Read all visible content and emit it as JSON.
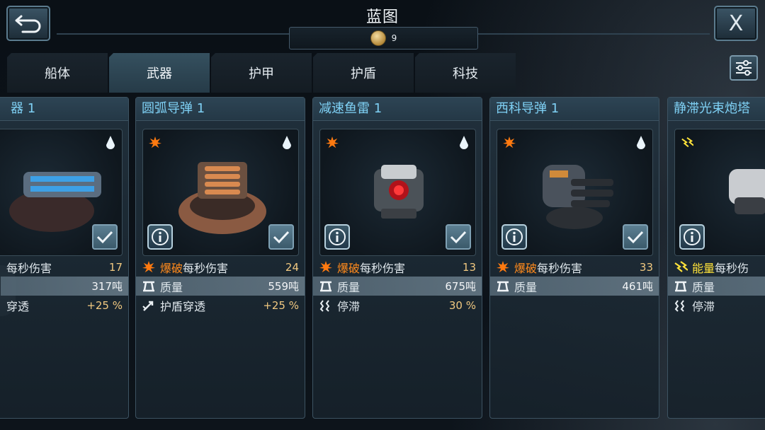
{
  "header": {
    "title": "蓝图",
    "coins": "9",
    "close_label": "X"
  },
  "tabs": [
    {
      "label": "船体",
      "active": false
    },
    {
      "label": "武器",
      "active": true
    },
    {
      "label": "护甲",
      "active": false
    },
    {
      "label": "护盾",
      "active": false
    },
    {
      "label": "科技",
      "active": false
    }
  ],
  "colors": {
    "accent_title": "#7fd1f5",
    "explosive": "#ff8a1c",
    "energy": "#ffe33a",
    "value": "#f0c880"
  },
  "cards": [
    {
      "title": "器 1",
      "stats": [
        {
          "icon": "dps-icon",
          "prefix": "",
          "label": "每秒伤害",
          "value": "17"
        },
        {
          "icon": "mass-icon",
          "prefix": "",
          "label": "",
          "value": "317吨"
        },
        {
          "icon": "penetration-icon",
          "prefix": "",
          "label": "穿透",
          "value": "+25 %"
        }
      ]
    },
    {
      "title": "圆弧导弹 1",
      "type_icon": "explosive-icon",
      "stats": [
        {
          "icon": "explosive-icon",
          "prefix": "爆破",
          "label": "每秒伤害",
          "value": "24"
        },
        {
          "icon": "mass-icon",
          "prefix": "",
          "label": "质量",
          "value": "559吨"
        },
        {
          "icon": "shield-penetration-icon",
          "prefix": "",
          "label": "护盾穿透",
          "value": "+25 %"
        }
      ]
    },
    {
      "title": "减速鱼雷 1",
      "type_icon": "explosive-icon",
      "stats": [
        {
          "icon": "explosive-icon",
          "prefix": "爆破",
          "label": "每秒伤害",
          "value": "13"
        },
        {
          "icon": "mass-icon",
          "prefix": "",
          "label": "质量",
          "value": "675吨"
        },
        {
          "icon": "stasis-icon",
          "prefix": "",
          "label": "停滞",
          "value": "30 %"
        }
      ]
    },
    {
      "title": "西科导弹 1",
      "type_icon": "explosive-icon",
      "stats": [
        {
          "icon": "explosive-icon",
          "prefix": "爆破",
          "label": "每秒伤害",
          "value": "33"
        },
        {
          "icon": "mass-icon",
          "prefix": "",
          "label": "质量",
          "value": "461吨"
        }
      ]
    },
    {
      "title": "静滞光束炮塔",
      "type_icon": "energy-icon",
      "stats": [
        {
          "icon": "energy-icon",
          "prefix": "能量",
          "label": "每秒伤",
          "value": ""
        },
        {
          "icon": "mass-icon",
          "prefix": "",
          "label": "质量",
          "value": ""
        },
        {
          "icon": "stasis-icon",
          "prefix": "",
          "label": "停滞",
          "value": ""
        }
      ]
    }
  ]
}
